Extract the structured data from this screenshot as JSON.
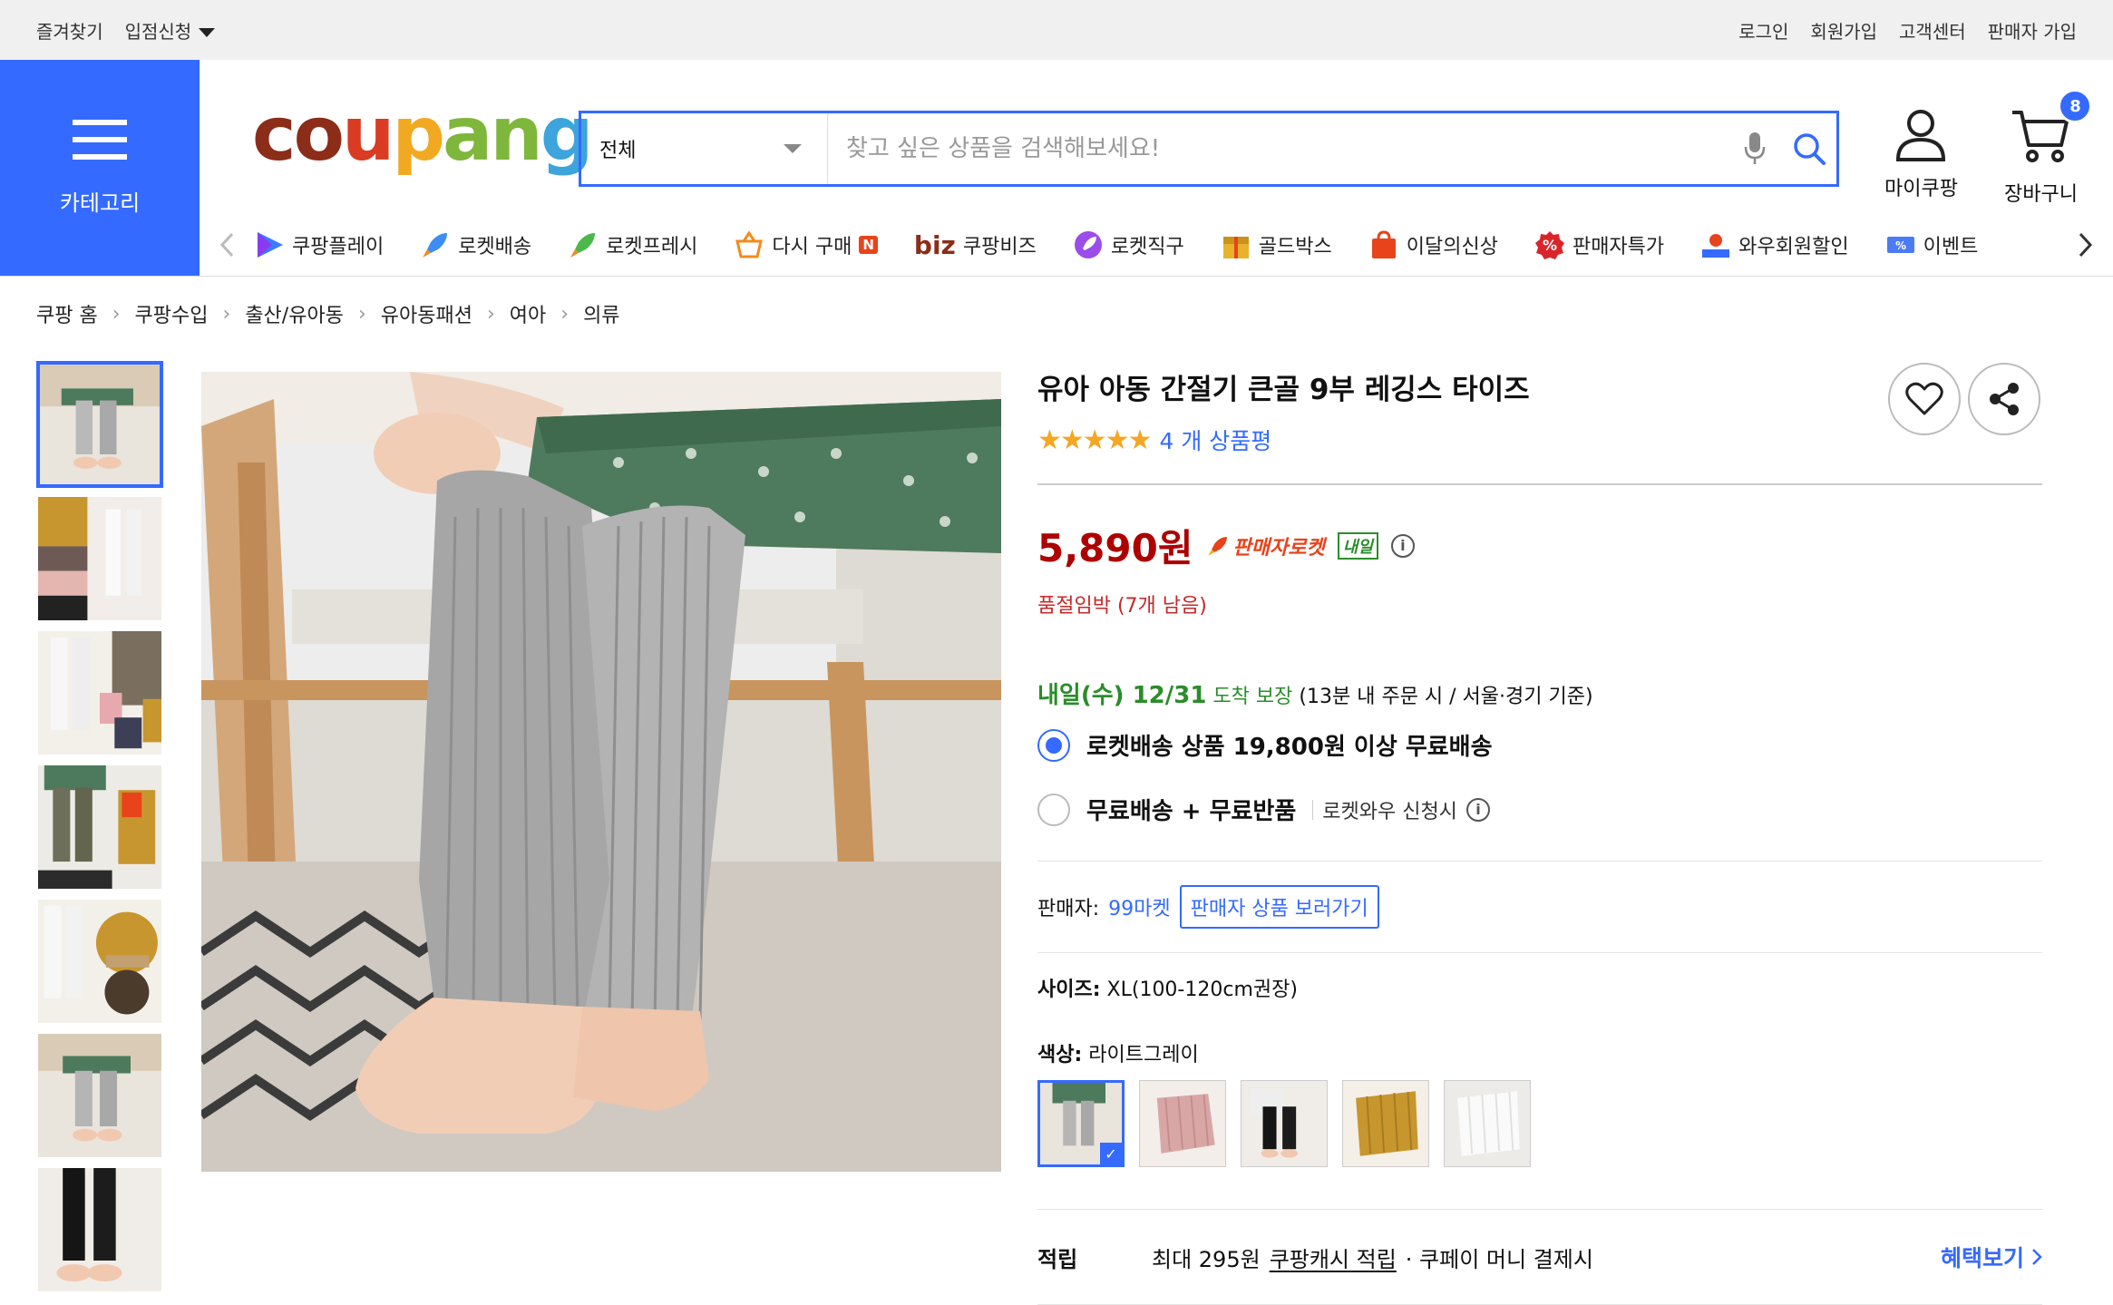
{
  "topbar": {
    "bookmark": "즐겨찾기",
    "apply": "입점신청",
    "login": "로그인",
    "signup": "회원가입",
    "support": "고객센터",
    "seller_signup": "판매자 가입"
  },
  "header": {
    "category_label": "카테고리",
    "logo": {
      "c1": "co",
      "c2": "u",
      "c3": "p",
      "c4": "an",
      "c5": "g"
    },
    "search_scope": "전체",
    "search_placeholder": "찾고 싶은 상품을 검색해보세요!",
    "mycoupang": "마이쿠팡",
    "cart": "장바구니",
    "cart_count": "8"
  },
  "shortcuts": [
    {
      "label": "쿠팡플레이",
      "icon": "play-icon"
    },
    {
      "label": "로켓배송",
      "icon": "rocket-icon"
    },
    {
      "label": "로켓프레시",
      "icon": "rocket-fresh-icon"
    },
    {
      "label": "다시 구매",
      "icon": "basket-icon",
      "badge": "N"
    },
    {
      "label": "쿠팡비즈",
      "icon": "biz-icon",
      "prefix": "biz"
    },
    {
      "label": "로켓직구",
      "icon": "rocket-global-icon"
    },
    {
      "label": "골드박스",
      "icon": "goldbox-icon"
    },
    {
      "label": "이달의신상",
      "icon": "new-bag-icon"
    },
    {
      "label": "판매자특가",
      "icon": "percent-icon"
    },
    {
      "label": "와우회원할인",
      "icon": "wow-icon"
    },
    {
      "label": "이벤트",
      "icon": "event-icon"
    }
  ],
  "breadcrumb": [
    "쿠팡 홈",
    "쿠팡수입",
    "출산/유아동",
    "유아동패션",
    "여아",
    "의류"
  ],
  "product": {
    "title": "유아 아동 간절기 큰골 9부 레깅스 타이즈",
    "stars": "★★★★★",
    "review_count": "4 개 상품평",
    "price": "5,890원",
    "rocket_label": "판매자로켓",
    "tomorrow_badge": "내일",
    "stock": "품절임박 (7개 남음)",
    "delivery_date": "내일(수) 12/31",
    "delivery_guarantee": "도착 보장",
    "delivery_note": "(13분 내 주문 시 / 서울·경기 기준)",
    "option1": "로켓배송 상품 19,800원 이상 무료배송",
    "option2": "무료배송 + 무료반품",
    "option2_sub": "로켓와우 신청시",
    "seller_label": "판매자:",
    "seller_name": "99마켓",
    "seller_button": "판매자 상품 보러가기",
    "size_label": "사이즈:",
    "size_value": "XL(100-120cm권장)",
    "color_label": "색상:",
    "color_value": "라이트그레이",
    "points_label": "적립",
    "points_max": "최대 295원",
    "points_link": "쿠팡캐시 적립",
    "points_rest": "· 쿠페이 머니 결제시",
    "benefit_link": "혜택보기"
  },
  "colors": {
    "accent": "#346aff",
    "price": "#ae0000",
    "delivery": "#2a8d2a"
  }
}
